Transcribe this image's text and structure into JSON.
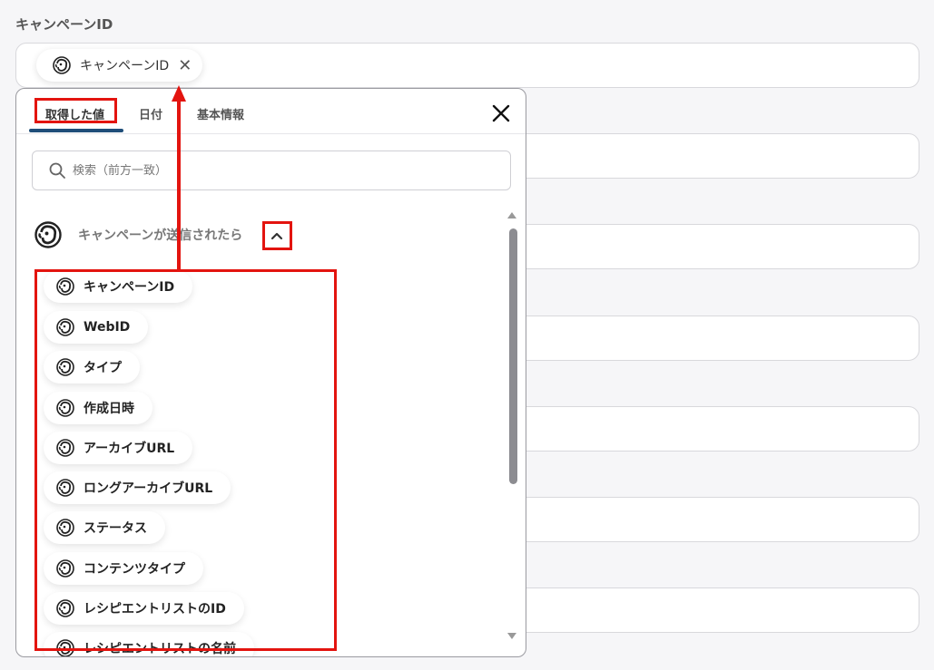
{
  "field": {
    "label": "キャンペーンID",
    "chip_label": "キャンペーンID",
    "chip_remove_icon": "close-icon"
  },
  "popup": {
    "tabs": [
      {
        "label": "取得した値",
        "active": true
      },
      {
        "label": "日付",
        "active": false
      },
      {
        "label": "基本情報",
        "active": false
      }
    ],
    "close_icon": "close-icon",
    "search": {
      "placeholder": "検索（前方一致）",
      "value": ""
    },
    "group": {
      "title": "キャンペーンが送信されたら",
      "icon": "mailchimp-icon",
      "expanded": true,
      "items": [
        {
          "label": "キャンペーンID"
        },
        {
          "label": "WebID"
        },
        {
          "label": "タイプ"
        },
        {
          "label": "作成日時"
        },
        {
          "label": "アーカイブURL"
        },
        {
          "label": "ロングアーカイブURL"
        },
        {
          "label": "ステータス"
        },
        {
          "label": "コンテンツタイプ"
        },
        {
          "label": "レシピエントリストのID"
        },
        {
          "label": "レシピエントリストの名前"
        }
      ]
    }
  },
  "colors": {
    "highlight": "#e3140f",
    "tab_underline": "#1f4e79",
    "scrollbar": "#8c8c91"
  }
}
